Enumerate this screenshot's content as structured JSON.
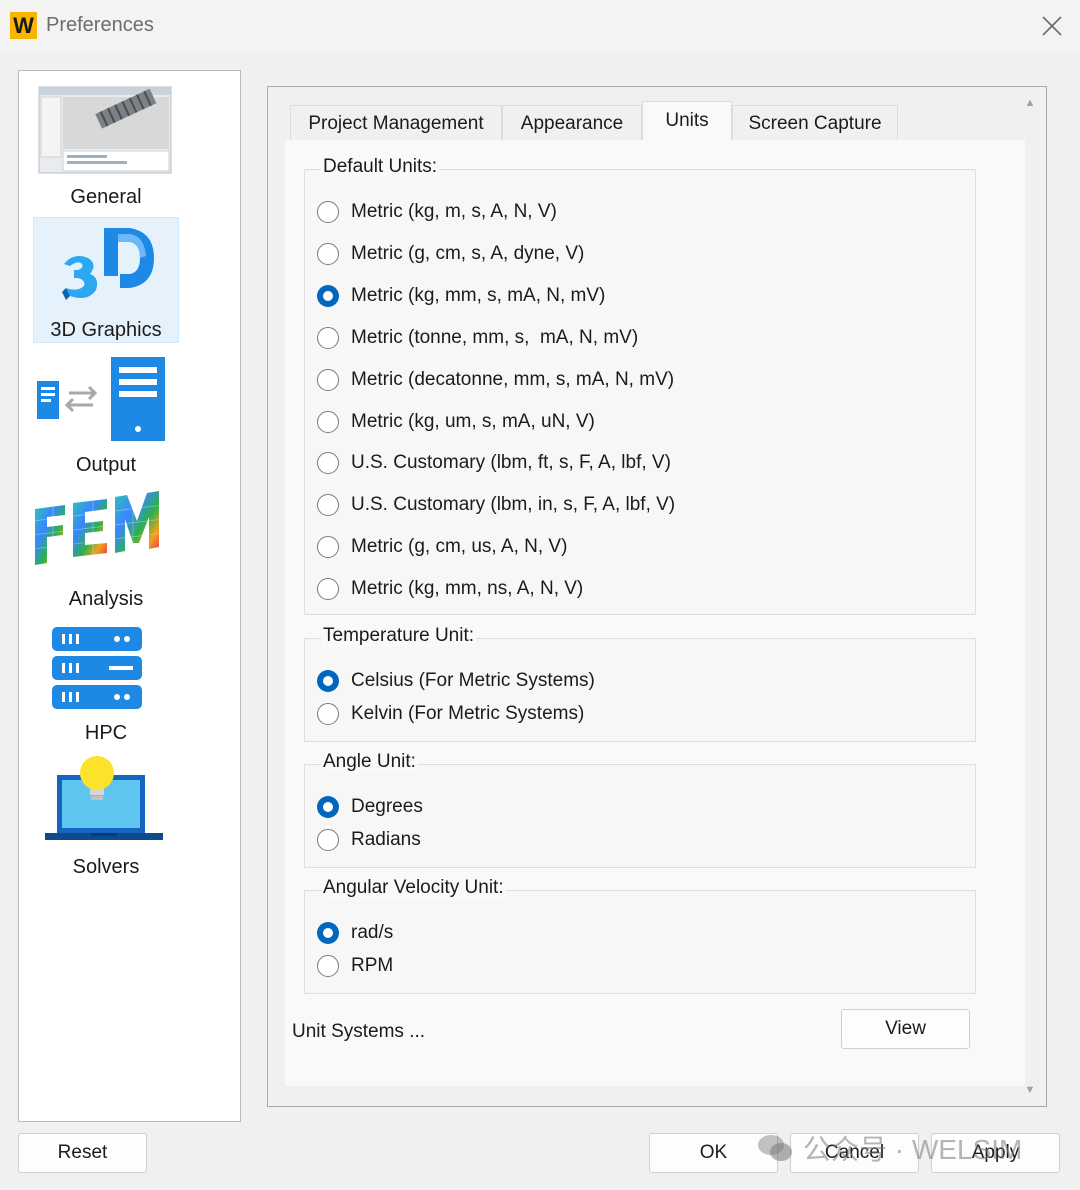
{
  "window": {
    "logo_letter": "W",
    "title": "Preferences",
    "close_symbol": "✕"
  },
  "sidebar": {
    "items": [
      {
        "label": "General",
        "icon": "general-screenshot-icon"
      },
      {
        "label": "3D Graphics",
        "icon": "3d-graphics-icon",
        "selected": true
      },
      {
        "label": "Output",
        "icon": "output-icon"
      },
      {
        "label": "Analysis",
        "icon": "fem-analysis-icon"
      },
      {
        "label": "HPC",
        "icon": "hpc-server-icon"
      },
      {
        "label": "Solvers",
        "icon": "solvers-laptop-bulb-icon"
      }
    ]
  },
  "tabs": [
    {
      "label": "Project Management"
    },
    {
      "label": "Appearance"
    },
    {
      "label": "Units",
      "active": true
    },
    {
      "label": "Screen Capture"
    }
  ],
  "default_units": {
    "title": "Default Units:",
    "selected_index": 2,
    "options": [
      "Metric (kg, m, s, A, N, V)",
      "Metric (g, cm, s, A, dyne, V)",
      "Metric (kg, mm, s, mA, N, mV)",
      "Metric (tonne, mm, s,  mA, N, mV)",
      "Metric (decatonne, mm, s, mA, N, mV)",
      "Metric (kg, um, s, mA, uN, V)",
      "U.S. Customary (lbm, ft, s, F, A, lbf, V)",
      "U.S. Customary (lbm, in, s, F, A, lbf, V)",
      "Metric (g, cm, us, A, N, V)",
      "Metric (kg, mm, ns, A, N, V)"
    ]
  },
  "temperature_unit": {
    "title": "Temperature Unit:",
    "selected_index": 0,
    "options": [
      "Celsius (For Metric Systems)",
      "Kelvin (For Metric Systems)"
    ]
  },
  "angle_unit": {
    "title": "Angle Unit:",
    "selected_index": 0,
    "options": [
      "Degrees",
      "Radians"
    ]
  },
  "angular_velocity_unit": {
    "title": "Angular Velocity Unit:",
    "selected_index": 0,
    "options": [
      "rad/s",
      "RPM"
    ]
  },
  "unit_systems": {
    "label": "Unit Systems ...",
    "view_button": "View"
  },
  "footer": {
    "reset": "Reset",
    "ok": "OK",
    "cancel": "Cancel",
    "apply": "Apply"
  },
  "watermark": {
    "text": "公众号 · WELSIM"
  },
  "colors": {
    "accent": "#0067c0",
    "logo": "#f7b500",
    "selected_item_bg": "#e5f1fb"
  }
}
